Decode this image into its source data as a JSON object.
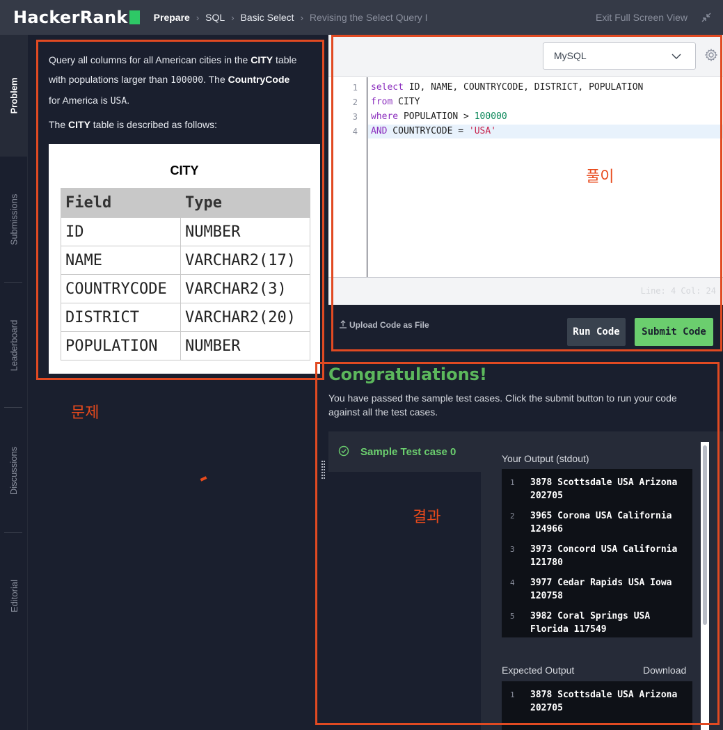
{
  "header": {
    "logo_text": "HackerRank",
    "breadcrumbs": [
      "Prepare",
      "SQL",
      "Basic Select",
      "Revising the Select Query I"
    ],
    "exit_label": "Exit Full Screen View"
  },
  "rail": {
    "tabs": [
      "Problem",
      "Submissions",
      "Leaderboard",
      "Discussions",
      "Editorial"
    ]
  },
  "problem": {
    "p1_a": "Query all columns for all American cities in the ",
    "p1_b": "CITY",
    "p1_c": " table with populations larger than ",
    "p1_d": "100000",
    "p1_e": ". The ",
    "p1_f": "CountryCode",
    "p1_g": " for America is ",
    "p1_h": "USA",
    "p1_i": ".",
    "p2_a": "The ",
    "p2_b": "CITY",
    "p2_c": " table is described as follows:",
    "table": {
      "title": "CITY",
      "headers": [
        "Field",
        "Type"
      ],
      "rows": [
        [
          "ID",
          "NUMBER"
        ],
        [
          "NAME",
          "VARCHAR2(17)"
        ],
        [
          "COUNTRYCODE",
          "VARCHAR2(3)"
        ],
        [
          "DISTRICT",
          "VARCHAR2(20)"
        ],
        [
          "POPULATION",
          "NUMBER"
        ]
      ]
    }
  },
  "annotations": {
    "problem": "문제",
    "solution": "풀이",
    "result": "결과"
  },
  "editor": {
    "language": "MySQL",
    "line_numbers": [
      "1",
      "2",
      "3",
      "4"
    ],
    "code": {
      "l1_kw": "select",
      "l1_rest": " ID, NAME, COUNTRYCODE, DISTRICT, POPULATION",
      "l2_kw": "from",
      "l2_rest": " CITY",
      "l3_kw": "where",
      "l3_rest": " POPULATION > ",
      "l3_num": "100000",
      "l4_kw": "AND",
      "l4_rest": " COUNTRYCODE = ",
      "l4_str": "'USA'"
    },
    "status": "Line: 4 Col: 24",
    "upload_label": "Upload Code as File",
    "run_label": "Run Code",
    "submit_label": "Submit Code"
  },
  "results": {
    "title": "Congratulations!",
    "subtitle": "You have passed the sample test cases. Click the submit button to run your code against all the test cases.",
    "test_case": "Sample Test case 0",
    "your_output_label": "Your Output (stdout)",
    "your_output": [
      {
        "n": "1",
        "text": "3878 Scottsdale USA Arizona 202705"
      },
      {
        "n": "2",
        "text": "3965 Corona USA California 124966"
      },
      {
        "n": "3",
        "text": "3973 Concord USA California 121780"
      },
      {
        "n": "4",
        "text": "3977 Cedar Rapids USA Iowa 120758"
      },
      {
        "n": "5",
        "text": "3982 Coral Springs USA Florida 117549"
      }
    ],
    "expected_label": "Expected Output",
    "download_label": "Download",
    "expected_output": [
      {
        "n": "1",
        "text": "3878 Scottsdale USA Arizona 202705"
      }
    ]
  },
  "colors": {
    "accent_green": "#2ec866",
    "success_green": "#5cb85c",
    "annotation_red": "#e14a22"
  }
}
